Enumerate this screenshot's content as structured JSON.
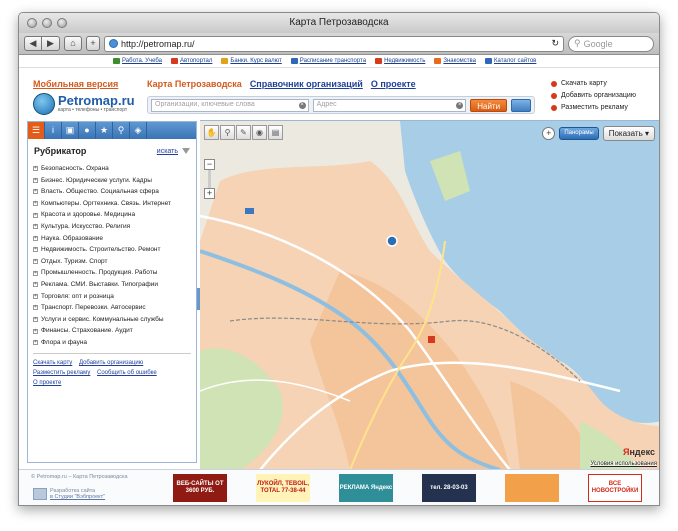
{
  "browser": {
    "window_title": "Карта Петрозаводска",
    "url": "http://petromap.ru/",
    "search_placeholder": "Google",
    "bookmarks": [
      {
        "label": "Работа. Учеба",
        "color": "#3a8f2c"
      },
      {
        "label": "Автопортал",
        "color": "#d63a1c"
      },
      {
        "label": "Банки. Курс валют",
        "color": "#e0a21b"
      },
      {
        "label": "Расписание транспорта",
        "color": "#3067b8"
      },
      {
        "label": "Недвижимость",
        "color": "#d63a1c"
      },
      {
        "label": "Знакомства",
        "color": "#e86a1d"
      },
      {
        "label": "Каталог сайтов",
        "color": "#3067b8"
      }
    ]
  },
  "header": {
    "mobile_link": "Мобильная версия",
    "logo_name": "Petromap.ru",
    "logo_tagline": "карта • телефоны • транспорт",
    "nav": {
      "map": "Карта Петрозаводска",
      "directory": "Справочник организаций",
      "about": "О проекте"
    },
    "search": {
      "org_placeholder": "Организации, ключевые слова",
      "address_placeholder": "Адрес",
      "find_button": "Найти"
    },
    "right_links": {
      "download_map": "Скачать карту",
      "add_org": "Добавить организацию",
      "ads": "Разместить рекламу"
    }
  },
  "sidebar": {
    "title": "Рубрикатор",
    "find_label": "искать",
    "categories": [
      "Безопасность. Охрана",
      "Бизнес. Юридические услуги. Кадры",
      "Власть. Общество. Социальная сфера",
      "Компьютеры. Оргтехника. Связь. Интернет",
      "Красота и здоровье. Медицина",
      "Культура. Искусство. Религия",
      "Наука. Образование",
      "Недвижимость. Строительство. Ремонт",
      "Отдых. Туризм. Спорт",
      "Промышленность. Продукция. Работы",
      "Реклама. СМИ. Выставки. Типографии",
      "Торговля: опт и розница",
      "Транспорт. Перевозки. Автосервис",
      "Услуги и сервис. Коммунальные службы",
      "Финансы. Страхование. Аудит",
      "Флора и фауна"
    ],
    "footer_links": {
      "download_map": "Скачать карту",
      "add_org": "Добавить организацию",
      "ads": "Разместить рекламу",
      "report_error": "Сообщить об ошибке",
      "about": "О проекте"
    }
  },
  "map": {
    "panorama_label": "Панорамы",
    "show_button": "Показать",
    "brand_y": "Я",
    "brand_rest": "ндекс",
    "terms": "Условия использования"
  },
  "footer": {
    "copyright": "© Petromap.ru – Карта Петрозаводска",
    "dev_line1": "Разработка сайта",
    "dev_line2": "в Студии \"Вэбпроект\"",
    "banners": [
      {
        "text": "ВЕБ-САЙТЫ ОТ 3600 РУБ.",
        "bg": "#8f1b12",
        "fg": "#ffffff"
      },
      {
        "text": "ЛУКОЙЛ, TEBOIL, TOTAL 77-38-44",
        "bg": "#fff3b8",
        "fg": "#c01818"
      },
      {
        "text": "РЕКЛАМА Яндекс",
        "bg": "#2f8f98",
        "fg": "#ffffff"
      },
      {
        "text": "тел. 28-03-03",
        "bg": "#24324f",
        "fg": "#ffffff"
      },
      {
        "text": "",
        "bg": "#f2a04a",
        "fg": "#ffffff"
      },
      {
        "text": "ВСЕ НОВОСТРОЙКИ",
        "bg": "#ffffff",
        "fg": "#d42a1a"
      }
    ]
  }
}
